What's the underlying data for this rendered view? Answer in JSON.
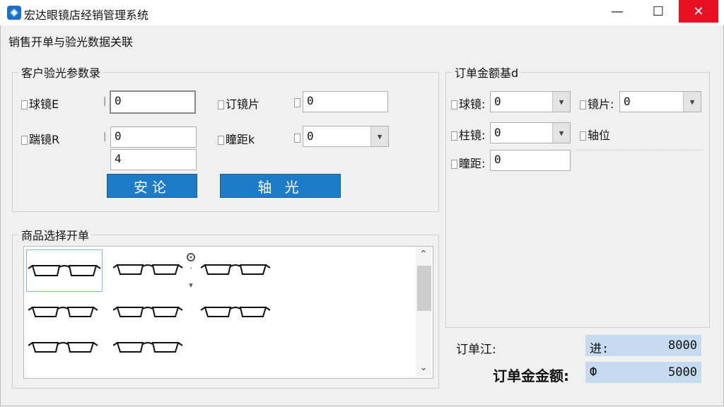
{
  "window": {
    "title": "宏达眼镜店经销管理系统",
    "minimize_glyph": "—",
    "maximize_glyph": "☐",
    "close_glyph": "✕"
  },
  "subtitle": "销售开单与验光数据关联",
  "params_group": {
    "legend": "客户验光参数录",
    "sphere_label": "球镜E",
    "sphere_value": "0",
    "custom_lens_label": "订镜片",
    "custom_lens_value": "0",
    "axis_label": "踹镜R",
    "axis_value": "0",
    "extra_value": "4",
    "pd_label": "瞳距k",
    "pd_value": "0",
    "btn_confirm": "安论",
    "btn_optometry": "轴 光"
  },
  "goods_group": {
    "legend": "商品选择开单"
  },
  "amount_group": {
    "legend": "订单金额基d",
    "sphere_label": "球镜:",
    "sphere_value": "0",
    "lens_label": "镜片:",
    "lens_value": "0",
    "cylinder_label": "柱镜:",
    "cylinder_value": "0",
    "axis_label": "轴位",
    "pd_label": "瞳距:",
    "pd_value": "0"
  },
  "summary": {
    "order_label": "订单江:",
    "order_box_label": "进:",
    "order_box_value": "8000",
    "total_label": "订单金金额:",
    "total_box_label": "Ф",
    "total_box_value": "5000"
  },
  "icons": {
    "app": "app-logo-icon",
    "glasses": "glasses-icon",
    "dropdown": "chevron-down-icon"
  },
  "colors": {
    "accent_button": "#1e7bc8",
    "summary_box": "#c6daf0",
    "close_button": "#e81123"
  }
}
